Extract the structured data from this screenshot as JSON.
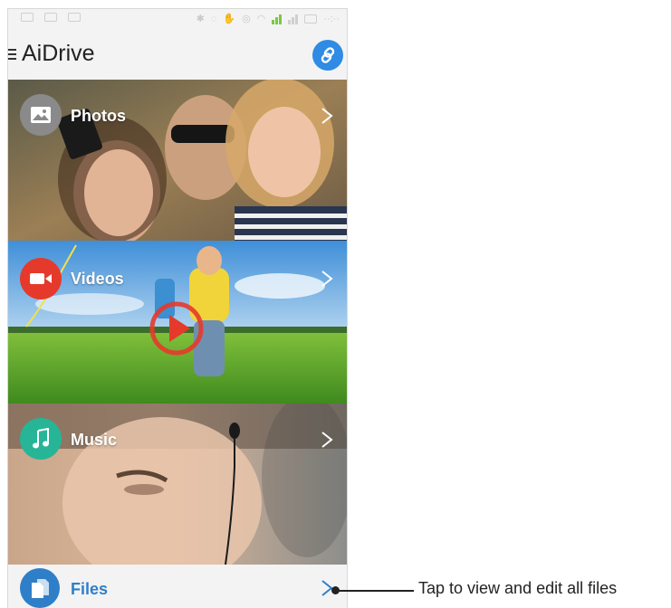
{
  "app": {
    "title": "AiDrive"
  },
  "categories": [
    {
      "label": "Photos",
      "icon": "image-icon",
      "color": "#8a8a8a"
    },
    {
      "label": "Videos",
      "icon": "video-camera-icon",
      "color": "#e53a2b"
    },
    {
      "label": "Music",
      "icon": "music-note-icon",
      "color": "#27b597"
    },
    {
      "label": "Files",
      "icon": "document-icon",
      "color": "#2f7fc8"
    }
  ],
  "callout": {
    "text": "Tap to view and edit all files"
  },
  "colors": {
    "accent": "#2f8be3",
    "files_text": "#2f7fc8",
    "background": "#f3f3f3"
  }
}
